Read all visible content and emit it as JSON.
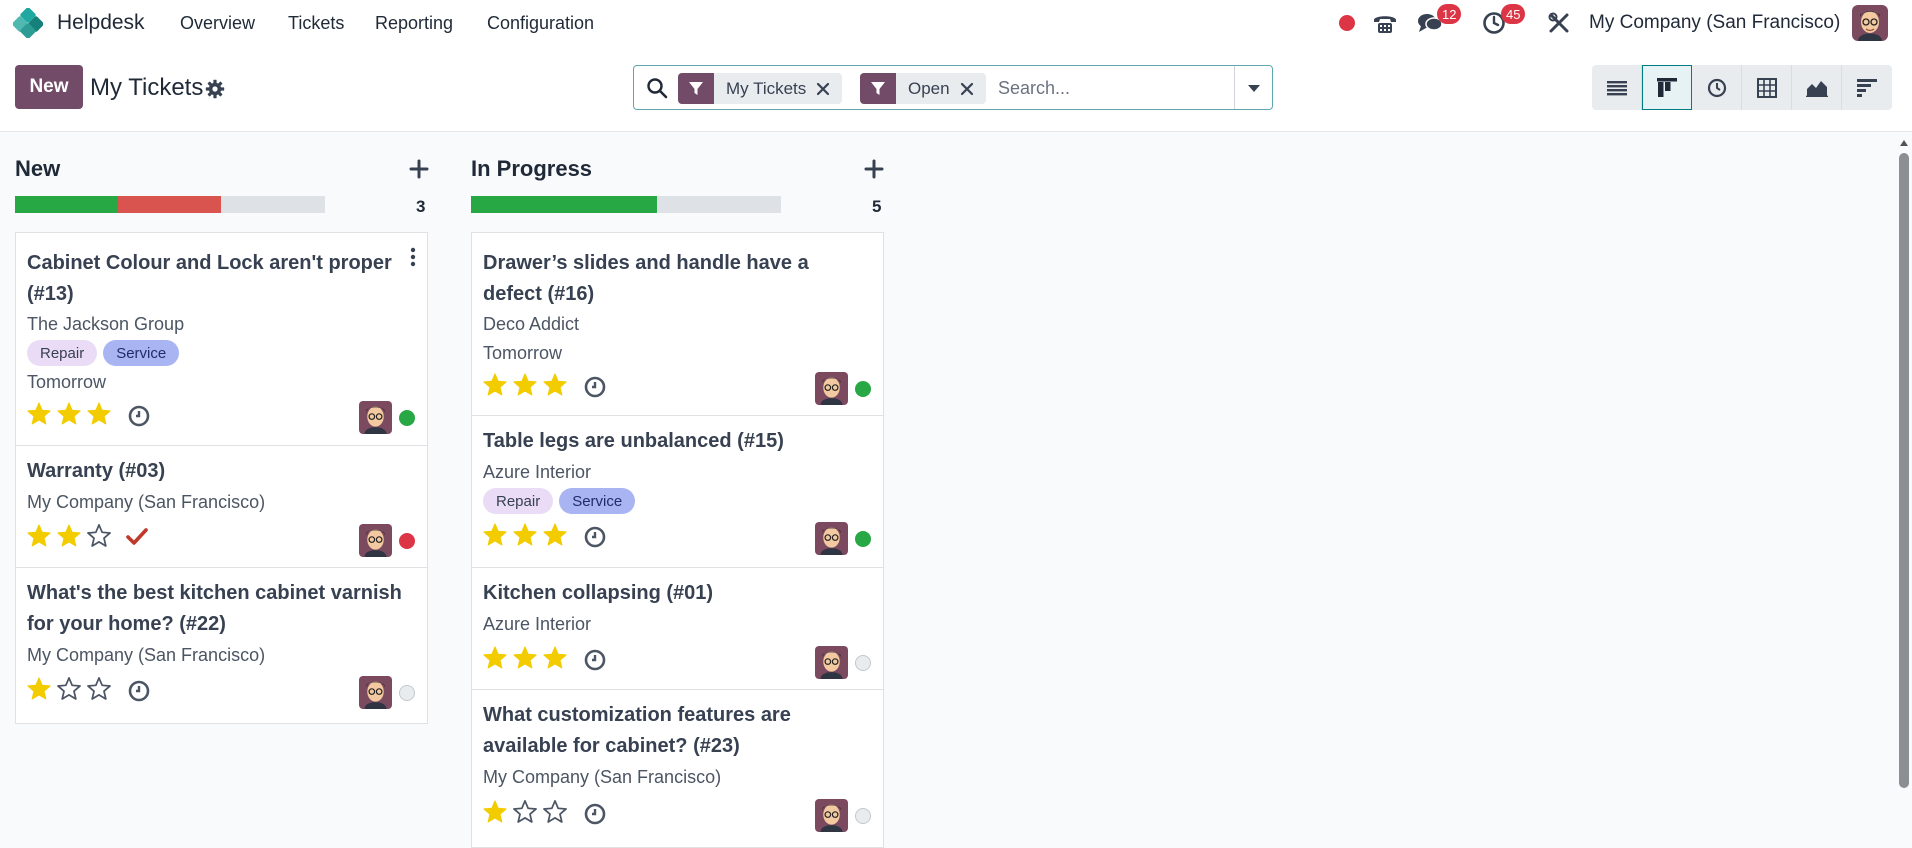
{
  "navbar": {
    "app_name": "Helpdesk",
    "menus": [
      "Overview",
      "Tickets",
      "Reporting",
      "Configuration"
    ],
    "messages_badge": "12",
    "activities_badge": "45",
    "company": "My Company (San Francisco)"
  },
  "control": {
    "new_label": "New",
    "title": "My Tickets",
    "facets": [
      "My Tickets",
      "Open"
    ],
    "search_placeholder": "Search..."
  },
  "columns": [
    {
      "title": "New",
      "count": "3",
      "progress": {
        "green": 0.333,
        "red": 0.333
      },
      "cards": [
        {
          "title": "Cabinet Colour and Lock aren't proper (#13)",
          "customer": "The Jackson Group",
          "tags": [
            "Repair",
            "Service"
          ],
          "deadline": "Tomorrow",
          "stars": 3,
          "activity": "clock-icon",
          "status": "green"
        },
        {
          "title": "Warranty (#03)",
          "customer": "My Company (San Francisco)",
          "tags": [],
          "deadline": "",
          "stars": 2,
          "activity": "check-icon",
          "status": "red"
        },
        {
          "title": "What's the best kitchen cabinet varnish for your home? (#22)",
          "customer": "My Company (San Francisco)",
          "tags": [],
          "deadline": "",
          "stars": 1,
          "activity": "clock-icon",
          "status": "grey"
        }
      ]
    },
    {
      "title": "In Progress",
      "count": "5",
      "progress": {
        "green": 0.6,
        "red": 0
      },
      "cards": [
        {
          "title": "Drawer’s slides and handle have a defect (#16)",
          "customer": "Deco Addict",
          "tags": [],
          "deadline": "Tomorrow",
          "stars": 3,
          "activity": "clock-icon",
          "status": "green"
        },
        {
          "title": "Table legs are unbalanced (#15)",
          "customer": "Azure Interior",
          "tags": [
            "Repair",
            "Service"
          ],
          "deadline": "",
          "stars": 3,
          "activity": "clock-icon",
          "status": "green"
        },
        {
          "title": "Kitchen collapsing (#01)",
          "customer": "Azure Interior",
          "tags": [],
          "deadline": "",
          "stars": 3,
          "activity": "clock-icon",
          "status": "grey"
        },
        {
          "title": "What customization features are available for cabinet? (#23)",
          "customer": "My Company (San Francisco)",
          "tags": [],
          "deadline": "",
          "stars": 1,
          "activity": "clock-icon",
          "status": "grey"
        }
      ]
    }
  ],
  "colors": {
    "brand": "#714b67",
    "accent": "#017e84",
    "star": "#f3cc00",
    "green": "#28a745",
    "red": "#dc3545"
  }
}
